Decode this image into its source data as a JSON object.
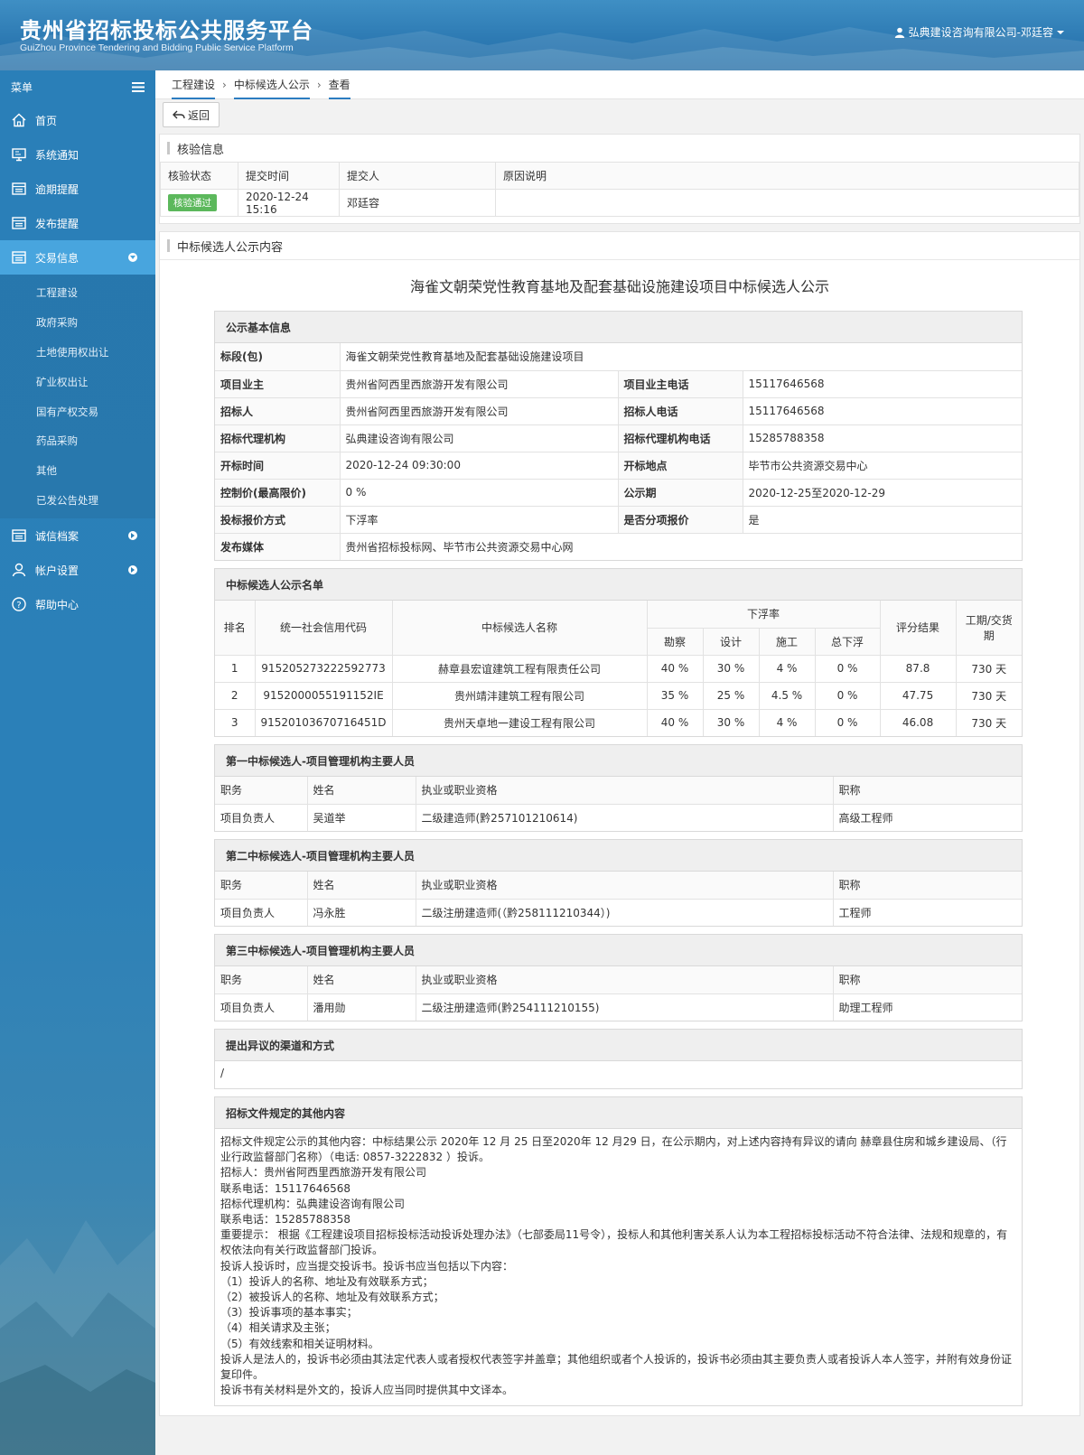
{
  "header": {
    "title_cn": "贵州省招标投标公共服务平台",
    "title_en": "GuiZhou Province Tendering and Bidding Public Service Platform",
    "user": "弘典建设咨询有限公司-邓廷容"
  },
  "sidebar": {
    "menu_label": "菜单",
    "items": [
      {
        "label": "首页",
        "icon": "home-icon"
      },
      {
        "label": "系统通知",
        "icon": "monitor-icon"
      },
      {
        "label": "逾期提醒",
        "icon": "list-icon"
      },
      {
        "label": "发布提醒",
        "icon": "list-icon"
      },
      {
        "label": "交易信息",
        "icon": "list-icon"
      }
    ],
    "sub_items": [
      "工程建设",
      "政府采购",
      "土地使用权出让",
      "矿业权出让",
      "国有产权交易",
      "药品采购",
      "其他",
      "已发公告处理"
    ],
    "bottom_items": [
      {
        "label": "诚信档案",
        "icon": "list-icon"
      },
      {
        "label": "帐户设置",
        "icon": "user-icon"
      },
      {
        "label": "帮助中心",
        "icon": "help-icon"
      }
    ]
  },
  "breadcrumb": [
    "工程建设",
    "中标候选人公示",
    "查看"
  ],
  "toolbar": {
    "back_label": "返回"
  },
  "verify": {
    "title": "核验信息",
    "headers": [
      "核验状态",
      "提交时间",
      "提交人",
      "原因说明"
    ],
    "status": "核验通过",
    "time": "2020-12-24 15:16",
    "submitter": "邓廷容",
    "reason": ""
  },
  "content": {
    "panel_title": "中标候选人公示内容",
    "doc_title": "海雀文朝荣党性教育基地及配套基础设施建设项目中标候选人公示",
    "basic": {
      "head": "公示基本信息",
      "section_label": "标段(包)",
      "section_value": "海雀文朝荣党性教育基地及配套基础设施建设项目",
      "rows": [
        [
          "项目业主",
          "贵州省阿西里西旅游开发有限公司",
          "项目业主电话",
          "15117646568"
        ],
        [
          "招标人",
          "贵州省阿西里西旅游开发有限公司",
          "招标人电话",
          "15117646568"
        ],
        [
          "招标代理机构",
          "弘典建设咨询有限公司",
          "招标代理机构电话",
          "15285788358"
        ],
        [
          "开标时间",
          "2020-12-24 09:30:00",
          "开标地点",
          "毕节市公共资源交易中心"
        ],
        [
          "控制价(最高限价)",
          "0 %",
          "公示期",
          "2020-12-25至2020-12-29"
        ],
        [
          "投标报价方式",
          "下浮率",
          "是否分项报价",
          "是"
        ]
      ],
      "media_label": "发布媒体",
      "media_value": "贵州省招标投标网、毕节市公共资源交易中心网"
    },
    "candidates": {
      "head": "中标候选人公示名单",
      "h_rank": "排名",
      "h_code": "统一社会信用代码",
      "h_name": "中标候选人名称",
      "h_rate": "下浮率",
      "h_survey": "勘察",
      "h_design": "设计",
      "h_build": "施工",
      "h_total": "总下浮",
      "h_score": "评分结果",
      "h_period": "工期/交货期",
      "rows": [
        [
          "1",
          "915205273222592773",
          "赫章县宏谊建筑工程有限责任公司",
          "40 %",
          "30 %",
          "4 %",
          "0 %",
          "87.8",
          "730 天"
        ],
        [
          "2",
          "9152000055191152IE",
          "贵州靖沣建筑工程有限公司",
          "35 %",
          "25 %",
          "4.5 %",
          "0 %",
          "47.75",
          "730 天"
        ],
        [
          "3",
          "91520103670716451D",
          "贵州天卓地一建设工程有限公司",
          "40 %",
          "30 %",
          "4 %",
          "0 %",
          "46.08",
          "730 天"
        ]
      ]
    },
    "staff_headers": [
      "职务",
      "姓名",
      "执业或职业资格",
      "职称"
    ],
    "staff": [
      {
        "head": "第一中标候选人-项目管理机构主要人员",
        "row": [
          "项目负责人",
          "吴道举",
          "二级建造师(黔257101210614)",
          "高级工程师"
        ]
      },
      {
        "head": "第二中标候选人-项目管理机构主要人员",
        "row": [
          "项目负责人",
          "冯永胜",
          "二级注册建造师(（黔258111210344）)",
          "工程师"
        ]
      },
      {
        "head": "第三中标候选人-项目管理机构主要人员",
        "row": [
          "项目负责人",
          "潘用勋",
          "二级注册建造师(黔254111210155)",
          "助理工程师"
        ]
      }
    ],
    "objection": {
      "head": "提出异议的渠道和方式",
      "value": "/"
    },
    "other": {
      "head": "招标文件规定的其他内容",
      "lines": [
        "招标文件规定公示的其他内容：中标结果公示 2020年 12 月 25 日至2020年 12 月29 日，在公示期内，对上述内容持有异议的请向 赫章县住房和城乡建设局、（行业行政监督部门名称）（电话: 0857-3222832 ）投诉。",
        "招标人：贵州省阿西里西旅游开发有限公司",
        "联系电话：15117646568",
        "招标代理机构：弘典建设咨询有限公司",
        "联系电话：15285788358",
        "重要提示： 根据《工程建设项目招标投标活动投诉处理办法》（七部委局11号令），投标人和其他利害关系人认为本工程招标投标活动不符合法律、法规和规章的，有权依法向有关行政监督部门投诉。",
        "投诉人投诉时，应当提交投诉书。投诉书应当包括以下内容：",
        "（1）投诉人的名称、地址及有效联系方式；",
        "（2）被投诉人的名称、地址及有效联系方式；",
        "（3）投诉事项的基本事实；",
        "（4）相关请求及主张；",
        "（5）有效线索和相关证明材料。",
        "投诉人是法人的，投诉书必须由其法定代表人或者授权代表签字并盖章；其他组织或者个人投诉的，投诉书必须由其主要负责人或者投诉人本人签字，并附有效身份证复印件。",
        "投诉书有关材料是外文的，投诉人应当同时提供其中文译本。"
      ]
    }
  }
}
